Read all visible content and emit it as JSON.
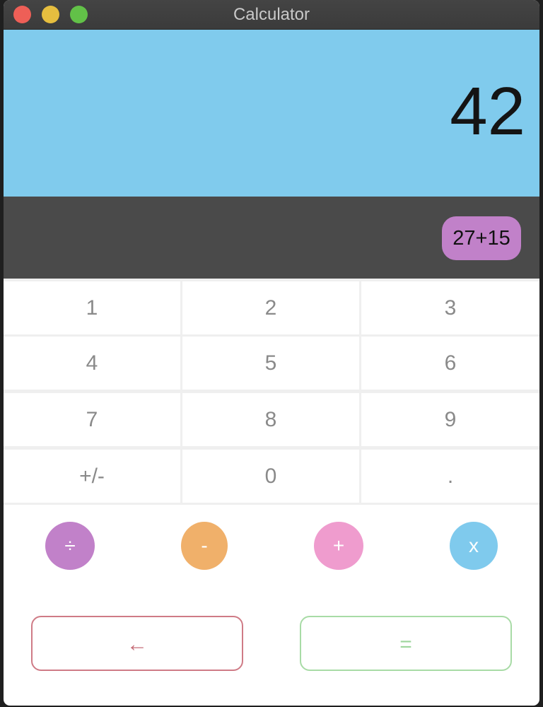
{
  "window": {
    "title": "Calculator"
  },
  "display": {
    "result": "42",
    "history": "27+15"
  },
  "keypad": {
    "keys": [
      "1",
      "2",
      "3",
      "4",
      "5",
      "6",
      "7",
      "8",
      "9",
      "+/-",
      "0",
      "."
    ]
  },
  "operators": {
    "divide": "÷",
    "subtract": "-",
    "add": "+",
    "multiply": "x"
  },
  "actions": {
    "backspace": "←",
    "equals": "="
  },
  "colors": {
    "display_bg": "#80cbed",
    "history_bg": "#4a4a4a",
    "history_chip": "#c181c9",
    "divide": "#c181c9",
    "subtract": "#f0b06a",
    "add": "#ef9cce",
    "multiply": "#7fcaed",
    "backspace": "#cf7b86",
    "equals": "#a8dba6"
  }
}
